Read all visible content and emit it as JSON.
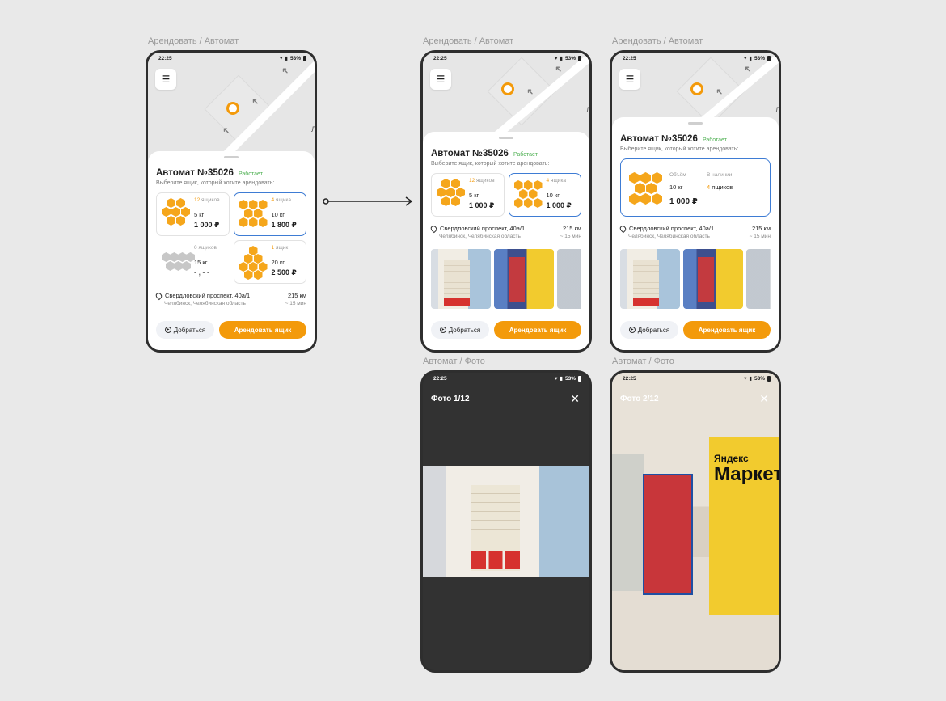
{
  "labels": {
    "rent": "Арендовать / Автомат",
    "photo": "Автомат / Фото"
  },
  "status": {
    "time": "22:25",
    "battery": "53%"
  },
  "map": {
    "letter": "Л"
  },
  "machine": {
    "title": "Автомат №35026",
    "state": "Работает",
    "subtitle": "Выберите ящик, который хотите арендовать:",
    "address": "Свердловский проспект, 40а/1",
    "city": "Челябинск, Челябинская область",
    "distance": "215 км",
    "time": "~ 15 мин"
  },
  "boxes": [
    {
      "count_num": "12",
      "count_word": " ящиков",
      "weight": "5 кг",
      "price": "1 000 ₽"
    },
    {
      "count_num": "4",
      "count_word": " ящика",
      "weight": "10 кг",
      "price": "1 800 ₽"
    },
    {
      "count_num": "0",
      "count_word": " ящиков",
      "weight": "15 кг",
      "price": "- , - -"
    },
    {
      "count_num": "1",
      "count_word": " ящик",
      "weight": "20 кг",
      "price": "2 500 ₽"
    }
  ],
  "boxes_v2": [
    {
      "count_num": "12",
      "count_word": " ящиков",
      "weight": "5 кг",
      "price": "1 000 ₽"
    },
    {
      "count_num": "4",
      "count_word": " ящика",
      "weight": "10 кг",
      "price": "1 000 ₽"
    }
  ],
  "info_card": {
    "volume_label": "Объём",
    "volume": "10 кг",
    "stock_label": "В наличии",
    "stock_num": "4",
    "stock_word": " ящиков",
    "price": "1 000 ₽"
  },
  "actions": {
    "go": "Добраться",
    "rent": "Арендовать ящик"
  },
  "photos": {
    "title1": "Фото 1/12",
    "title2": "Фото 2/12",
    "brand_top": "Яндекс",
    "brand_bottom": "Маркет"
  },
  "colors": {
    "accent": "#f39a0b",
    "selected": "#3e7cd4",
    "ok": "#4caf50"
  }
}
